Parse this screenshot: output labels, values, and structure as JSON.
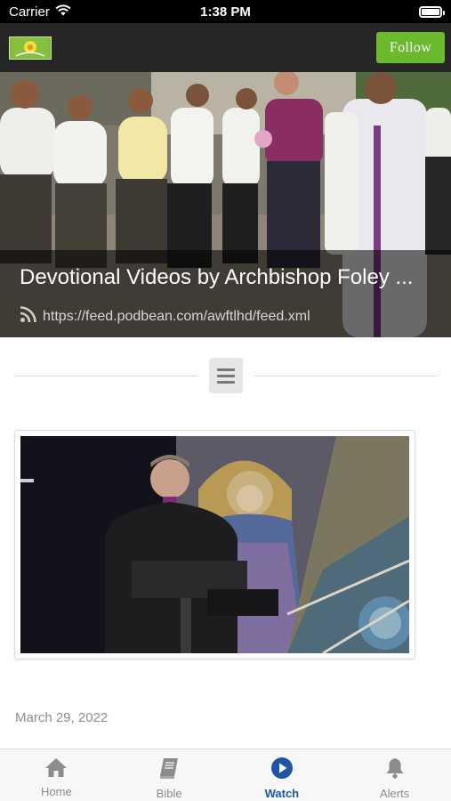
{
  "status_bar": {
    "carrier": "Carrier",
    "time": "1:38 PM"
  },
  "header": {
    "follow_label": "Follow"
  },
  "hero": {
    "title": "Devotional Videos by Archbishop Foley ...",
    "feed_url": "https://feed.podbean.com/awftlhd/feed.xml"
  },
  "episode": {
    "date": "March 29, 2022"
  },
  "tabs": [
    {
      "label": "Home",
      "icon": "home-icon"
    },
    {
      "label": "Bible",
      "icon": "bible-icon"
    },
    {
      "label": "Watch",
      "icon": "play-icon",
      "active": true
    },
    {
      "label": "Alerts",
      "icon": "bell-icon"
    }
  ],
  "colors": {
    "accent": "#1d57a3",
    "follow": "#6bb92d",
    "header_bg": "#262626"
  }
}
